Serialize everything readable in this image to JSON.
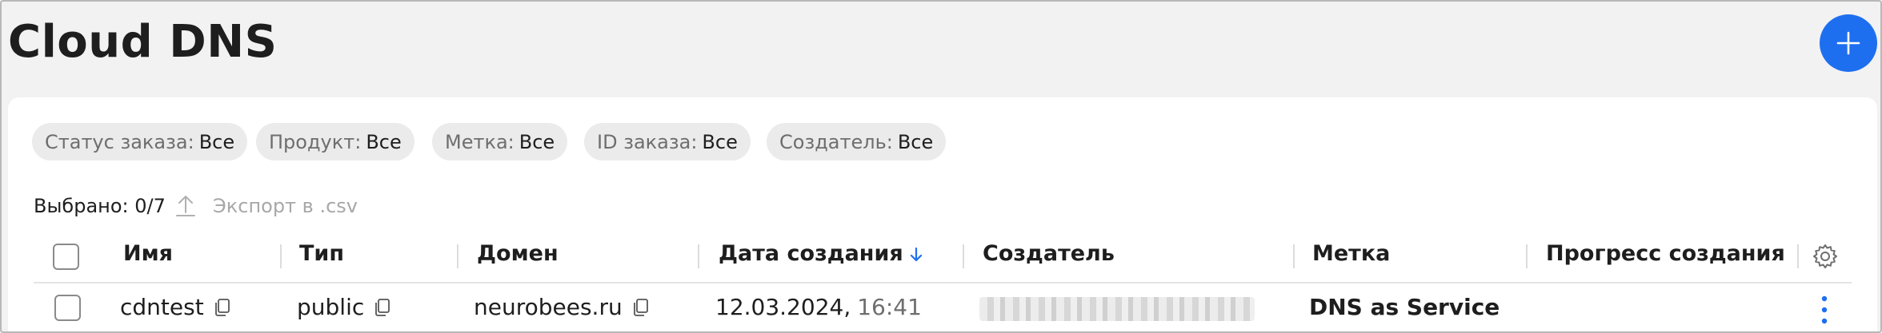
{
  "header": {
    "title": "Cloud DNS"
  },
  "filters": [
    {
      "label": "Статус заказа:",
      "value": "Все"
    },
    {
      "label": "Продукт:",
      "value": "Все"
    },
    {
      "label": "Метка:",
      "value": "Все"
    },
    {
      "label": "ID заказа:",
      "value": "Все"
    },
    {
      "label": "Создатель:",
      "value": "Все"
    }
  ],
  "selection": {
    "selected": "Выбрано: 0/7",
    "export_label": "Экспорт в .csv"
  },
  "table": {
    "columns": [
      "Имя",
      "Тип",
      "Домен",
      "Дата создания",
      "Создатель",
      "Метка",
      "Прогресс создания"
    ],
    "sort": {
      "column": "Дата создания",
      "direction": "descending"
    },
    "rows": [
      {
        "name": "cdntest",
        "type": "public",
        "domain": "neurobees.ru",
        "date": "12.03.2024,",
        "time": "16:41",
        "tag": "DNS as Service"
      }
    ]
  },
  "colors": {
    "accent": "#1e6ff0",
    "chip_bg": "#ebebeb",
    "muted": "#6e6e6e"
  },
  "icons": [
    "plus-icon",
    "upload-icon",
    "sort-down-arrow-icon",
    "gear-icon",
    "copy-icon",
    "kebab-menu-icon"
  ]
}
